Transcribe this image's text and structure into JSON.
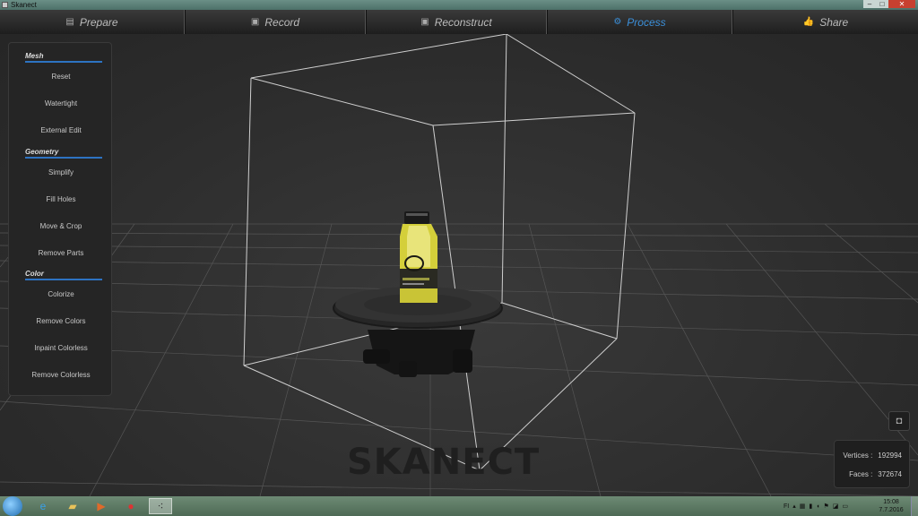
{
  "window": {
    "title": "Skanect",
    "minimize": "–",
    "maximize": "□",
    "close": "✕"
  },
  "nav": {
    "tabs": [
      {
        "label": "Prepare",
        "icon": "clipboard-icon",
        "glyph": "▤"
      },
      {
        "label": "Record",
        "icon": "record-icon",
        "glyph": "▣"
      },
      {
        "label": "Reconstruct",
        "icon": "reconstruct-icon",
        "glyph": "▣"
      },
      {
        "label": "Process",
        "icon": "gears-icon",
        "glyph": "⚙"
      },
      {
        "label": "Share",
        "icon": "thumbs-up-icon",
        "glyph": "👍"
      }
    ],
    "active": "Process"
  },
  "panel": {
    "mesh": {
      "title": "Mesh",
      "items": [
        "Reset",
        "Watertight",
        "External Edit"
      ]
    },
    "geometry": {
      "title": "Geometry",
      "items": [
        "Simplify",
        "Fill Holes",
        "Move & Crop",
        "Remove Parts"
      ]
    },
    "color": {
      "title": "Color",
      "items": [
        "Colorize",
        "Remove Colors",
        "Inpaint Colorless",
        "Remove Colorless"
      ]
    }
  },
  "stats": {
    "vertices_label": "Vertices :",
    "vertices_value": "192994",
    "faces_label": "Faces :",
    "faces_value": "372674"
  },
  "watermark": "SKANECT",
  "taskbar": {
    "apps": [
      "windows-start-icon",
      "internet-explorer-icon",
      "file-explorer-icon",
      "media-player-icon",
      "chrome-icon",
      "skanect-icon"
    ],
    "tray_lang": "FI",
    "clock_time": "15:08",
    "clock_date": "7.7.2016"
  },
  "colors": {
    "accent": "#3b8fd9",
    "section_underline": "#2d73c2"
  }
}
